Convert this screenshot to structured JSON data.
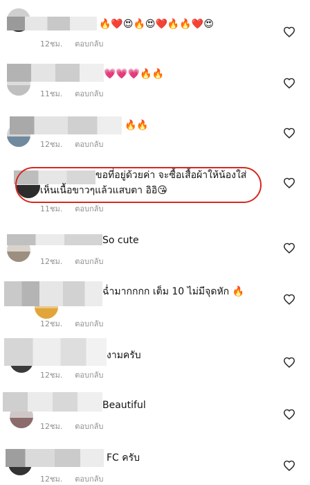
{
  "comments": [
    {
      "text": "🔥❤️😍🔥😍❤️🔥🔥❤️😍",
      "time": "12ชม.",
      "reply": "ตอบกลับ"
    },
    {
      "text": "💗💗💗🔥🔥",
      "time": "11ชม.",
      "reply": "ตอบกลับ"
    },
    {
      "text": "🔥🔥",
      "time": "12ชม.",
      "reply": "ตอบกลับ"
    },
    {
      "text_line1": "ขอที่อยู่ด้วยค่า จะซื้อเสื้อผ้าให้น้องใส่",
      "text_line2": "เห็นเนื้อขาวๆแล้วแสบตา อิอิ😘",
      "time": "11ชม.",
      "reply": "ตอบกลับ"
    },
    {
      "text": "So cute",
      "time": "12ชม.",
      "reply": "ตอบกลับ"
    },
    {
      "text": "ฉ่ำมากกกก เต็ม 10 ไม่มีจุดหัก 🔥",
      "time": "12ชม.",
      "reply": "ตอบกลับ"
    },
    {
      "text": "งามครับ",
      "time": "12ชม.",
      "reply": "ตอบกลับ"
    },
    {
      "text": "Beautiful",
      "time": "12ชม.",
      "reply": "ตอบกลับ"
    },
    {
      "text": "FC ครับ",
      "time": "12ชม.",
      "reply": "ตอบกลับ"
    }
  ],
  "icons": {
    "like": "heart-outline-icon"
  },
  "colors": {
    "highlight_ring": "#d7261e",
    "meta_text": "#8e8e8e",
    "heart_outline": "#262626"
  }
}
